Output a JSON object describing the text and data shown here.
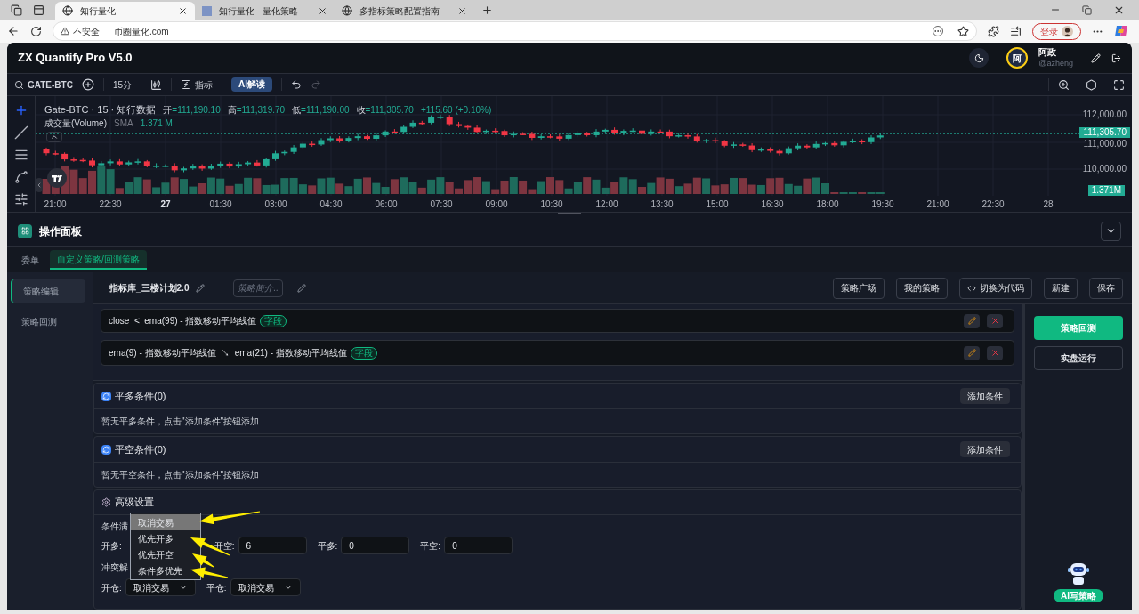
{
  "browser": {
    "tabs": [
      {
        "title": "知行量化",
        "selected": true
      },
      {
        "title": "知行量化 - 量化策略",
        "selected": false
      },
      {
        "title": "多指标策略配置指南",
        "selected": false
      }
    ],
    "security": "不安全",
    "url": "币圈量化.com",
    "login": "登录"
  },
  "app": {
    "title": "ZX Quantify Pro V5.0",
    "user": {
      "avatar": "阿",
      "name": "阿政",
      "handle": "@azheng"
    }
  },
  "toolbar": {
    "symbol": "GATE-BTC",
    "interval": "15分",
    "indicator": "指标",
    "ai": "AI解读"
  },
  "chart": {
    "title": "Gate-BTC · 15 · 知行数据",
    "ohlc": [
      {
        "label": "开",
        "value": "=111,190.10"
      },
      {
        "label": "高",
        "value": "=111,319.70"
      },
      {
        "label": "低",
        "value": "=111,190.00"
      },
      {
        "label": "收",
        "value": "=111,305.70"
      }
    ],
    "change": "+115.60 (+0.10%)",
    "volume": {
      "label": "成交量(Volume)",
      "sma": "SMA",
      "value": "1.371 M"
    },
    "yticks": [
      "112,000.00",
      "111,000.00",
      "110,000.00"
    ],
    "price_tag": "111,305.70",
    "volume_tag": "1.371M",
    "xticks": [
      {
        "label": "21:00",
        "bold": false
      },
      {
        "label": "22:30",
        "bold": false
      },
      {
        "label": "27",
        "bold": true
      },
      {
        "label": "01:30",
        "bold": false
      },
      {
        "label": "03:00",
        "bold": false
      },
      {
        "label": "04:30",
        "bold": false
      },
      {
        "label": "06:00",
        "bold": false
      },
      {
        "label": "07:30",
        "bold": false
      },
      {
        "label": "09:00",
        "bold": false
      },
      {
        "label": "10:30",
        "bold": false
      },
      {
        "label": "12:00",
        "bold": false
      },
      {
        "label": "13:30",
        "bold": false
      },
      {
        "label": "15:00",
        "bold": false
      },
      {
        "label": "16:30",
        "bold": false
      },
      {
        "label": "18:00",
        "bold": false
      },
      {
        "label": "19:30",
        "bold": false
      },
      {
        "label": "21:00",
        "bold": false
      },
      {
        "label": "22:30",
        "bold": false
      },
      {
        "label": "28",
        "bold": false
      }
    ]
  },
  "panel": {
    "title": "操作面板",
    "tabs": [
      {
        "label": "委单",
        "selected": false
      },
      {
        "label": "自定义策略/回测策略",
        "selected": true
      }
    ],
    "sidebar": [
      {
        "label": "策略编辑",
        "selected": true
      },
      {
        "label": "策略回测",
        "selected": false
      }
    ],
    "strategy_name": "指标库_三楼计划2.0",
    "description_placeholder": "策略简介...",
    "actions": [
      {
        "label": "策略广场",
        "kind": "plain"
      },
      {
        "label": "我的策略",
        "kind": "plain"
      },
      {
        "label": "切换为代码",
        "kind": "code"
      },
      {
        "label": "新建",
        "kind": "plain"
      },
      {
        "label": "保存",
        "kind": "plain"
      }
    ],
    "conditions": [
      {
        "text": "close  <  ema(99) - 指数移动平均线值",
        "tag": "字段"
      },
      {
        "text": "ema(9) - 指数移动平均线值  ↘  ema(21) - 指数移动平均线值",
        "tag": "字段"
      }
    ],
    "sections": [
      {
        "title": "平多条件(0)",
        "button": "添加条件",
        "empty": "暂无平多条件，点击\"添加条件\"按钮添加"
      },
      {
        "title": "平空条件(0)",
        "button": "添加条件",
        "empty": "暂无平空条件，点击\"添加条件\"按钮添加"
      }
    ],
    "advanced": {
      "title": "高级设置",
      "condition_label": "条件满",
      "thresholds": [
        {
          "label": "开多:"
        },
        {
          "label": "开空:",
          "value": "6"
        },
        {
          "label": "平多:",
          "value": "0"
        },
        {
          "label": "平空:",
          "value": "0"
        }
      ],
      "conflict_label": "冲突解",
      "selects": [
        {
          "label": "开仓:",
          "value": "取消交易"
        },
        {
          "label": "平仓:",
          "value": "取消交易"
        }
      ],
      "dropdown": [
        {
          "label": "取消交易",
          "selected": true
        },
        {
          "label": "优先开多",
          "selected": false
        },
        {
          "label": "优先开空",
          "selected": false
        },
        {
          "label": "条件多优先",
          "selected": false
        }
      ]
    },
    "run_buttons": [
      "策略回测",
      "实盘运行"
    ],
    "ai_button": "AI写策略"
  }
}
